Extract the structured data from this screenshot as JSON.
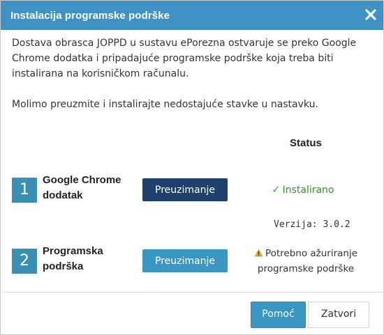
{
  "dialog": {
    "title": "Instalacija programske podrške",
    "close_icon": "close-icon"
  },
  "intro": {
    "paragraph1": "Dostava obrasca JOPPD u sustavu ePorezna ostvaruje se preko Google Chrome dodatka i pripadajuće programske podrške koja treba biti instalirana na korisničkom računalu.",
    "paragraph2": "Molimo preuzmite i instalirajte nedostajuće stavke u nastavku."
  },
  "status_header": "Status",
  "items": [
    {
      "number": "1",
      "name_line1": "Google Chrome",
      "name_line2": "dodatak",
      "button_label": "Preuzimanje",
      "status_icon": "checkmark-icon",
      "status_text": "Instalirano",
      "version_text": "Verzija: 3.0.2"
    },
    {
      "number": "2",
      "name_line1": "Programska",
      "name_line2": "podrška",
      "button_label": "Preuzimanje",
      "status_icon": "warning-icon",
      "status_line1": "Potrebno ažuriranje",
      "status_line2": "programske podrške"
    }
  ],
  "footer": {
    "help_label": "Pomoć",
    "close_label": "Zatvori"
  },
  "colors": {
    "titlebar": "#3e93c4",
    "number_badge": "#3a8fb4",
    "button_dark": "#1f3f6c",
    "button_light": "#3a97c2",
    "installed_green": "#3c8a3c",
    "warning_amber": "#e8a21c"
  }
}
